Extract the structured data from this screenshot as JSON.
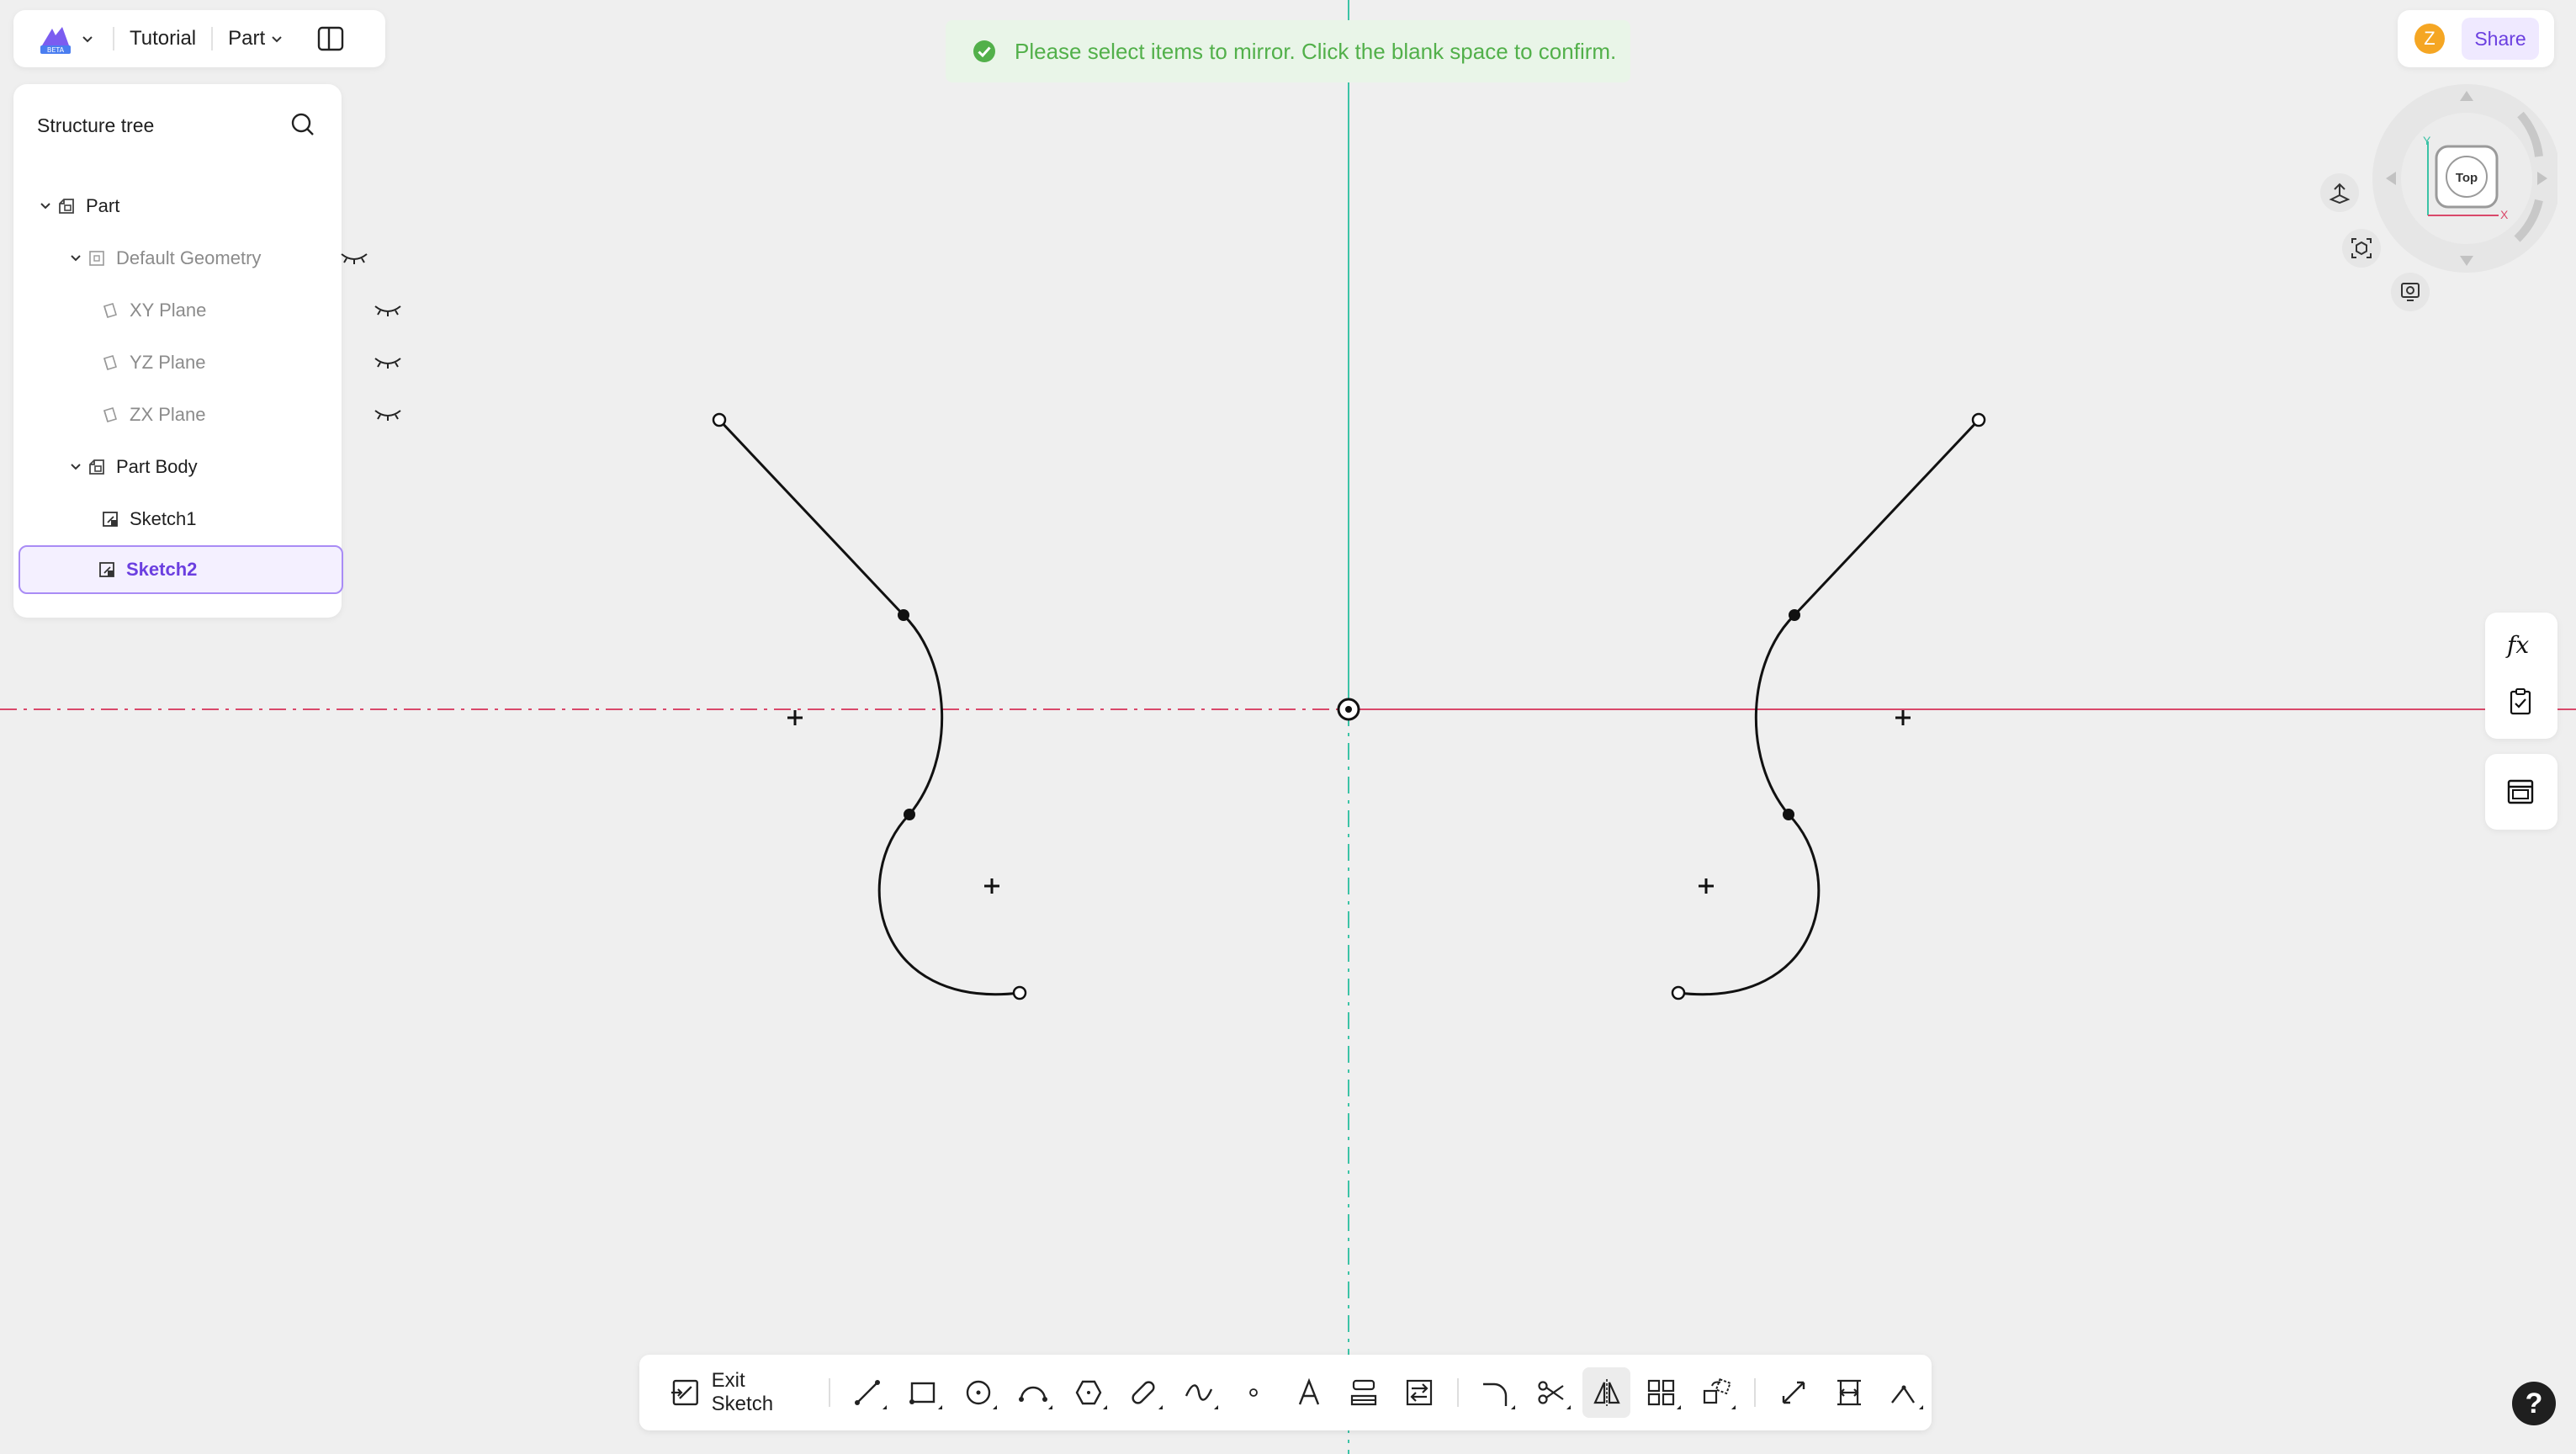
{
  "topbar": {
    "project": "Tutorial",
    "mode": "Part"
  },
  "tree": {
    "title": "Structure tree",
    "items": [
      {
        "label": "Part"
      },
      {
        "label": "Default Geometry"
      },
      {
        "label": "XY Plane"
      },
      {
        "label": "YZ Plane"
      },
      {
        "label": "ZX Plane"
      },
      {
        "label": "Part Body"
      },
      {
        "label": "Sketch1"
      },
      {
        "label": "Sketch2"
      }
    ]
  },
  "toast": {
    "message": "Please select items to mirror. Click the blank space to confirm."
  },
  "user": {
    "initial": "Z",
    "share_label": "Share"
  },
  "viewcube": {
    "face_label": "Top",
    "axis_y": "Y",
    "axis_x": "X"
  },
  "toolbar": {
    "exit_label": "Exit Sketch"
  },
  "help": {
    "label": "?"
  },
  "colors": {
    "accent": "#6b3fe0",
    "axis_red": "#d9486a",
    "axis_teal": "#3cc3a6",
    "success_text": "#52b04a",
    "avatar": "#f5a623"
  }
}
